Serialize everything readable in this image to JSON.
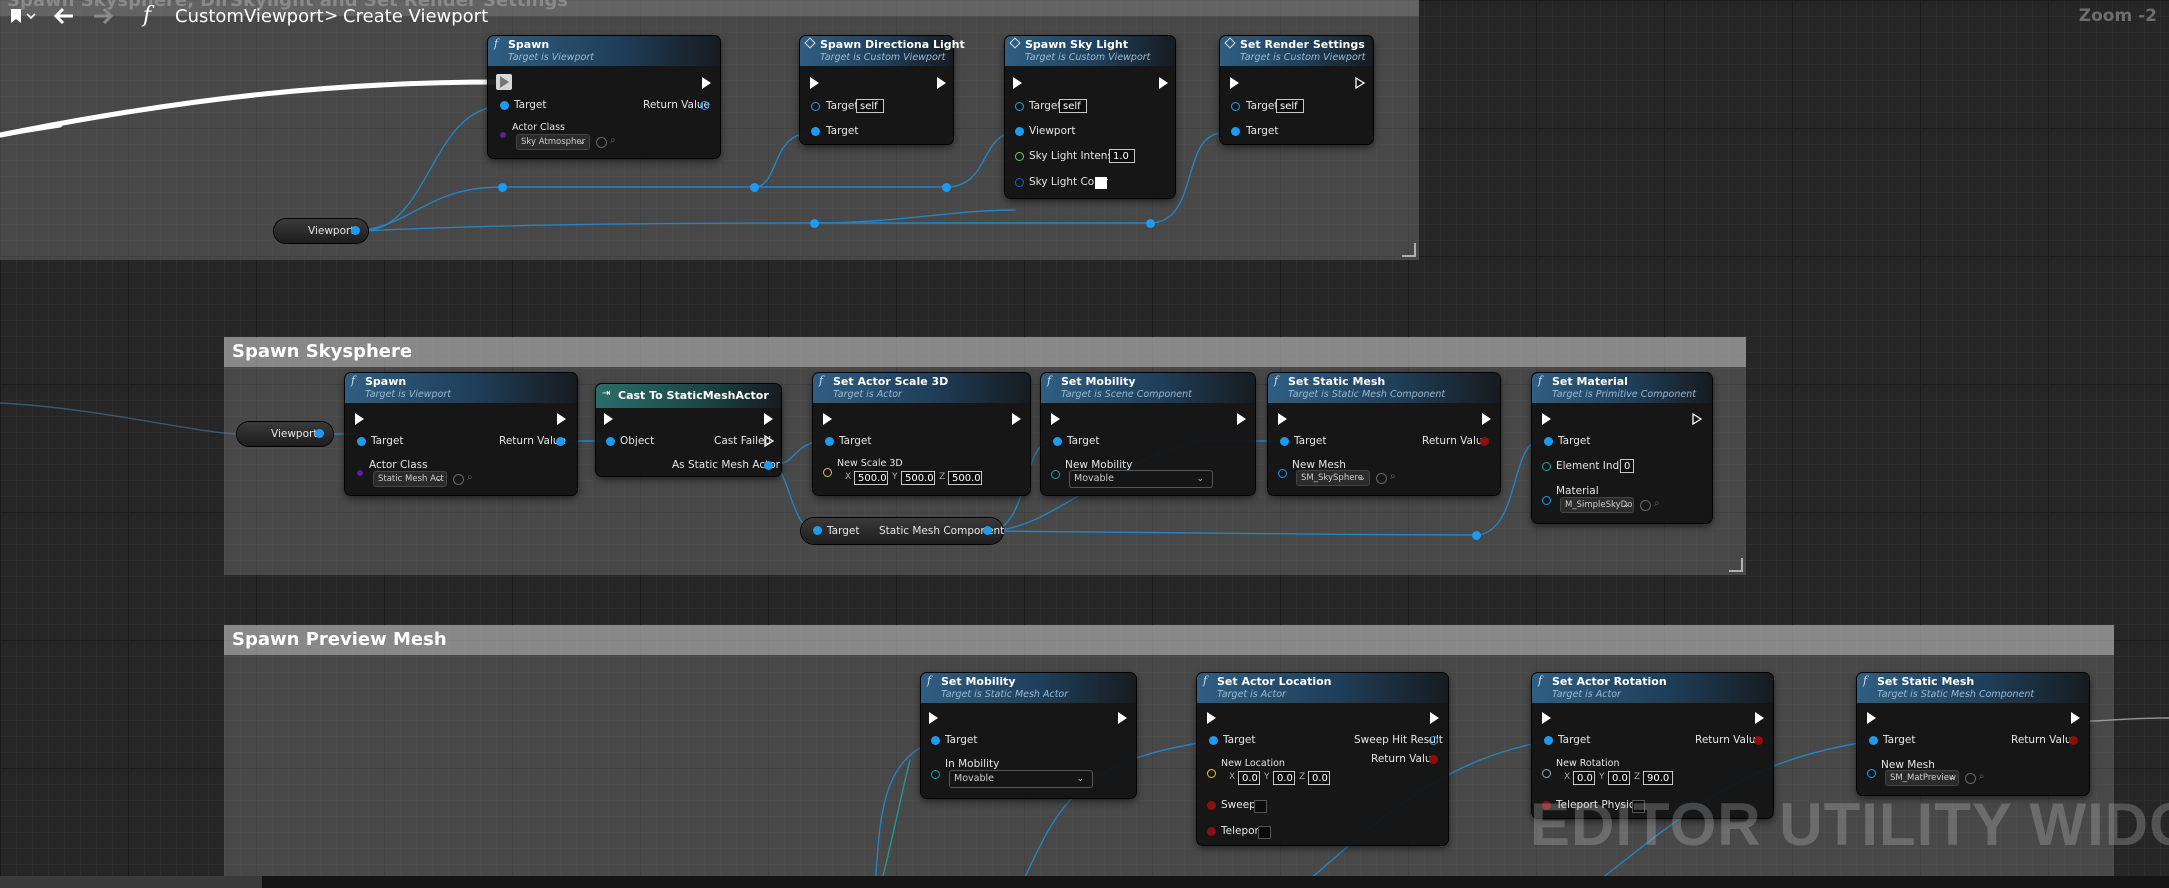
{
  "breadcrumb": {
    "function_name": "CustomViewport",
    "separator": ">",
    "graph_name": "Create Viewport"
  },
  "zoom": "Zoom -2",
  "watermark": "EDITOR UTILITY WIDGET",
  "comments": {
    "top": {
      "title": "Spawn Skysphere, DirSkylight and Set Render Settings"
    },
    "skysphere": {
      "title": "Spawn Skysphere"
    },
    "preview": {
      "title": "Spawn Preview Mesh"
    }
  },
  "top_nodes": {
    "spawn": {
      "title": "Spawn",
      "subtitle": "Target is Viewport",
      "target": "Target",
      "return": "Return Value",
      "actor_class": "Actor Class",
      "actor_class_value": "Sky Atmospher"
    },
    "dirlight": {
      "title": "Spawn Directiona Light",
      "subtitle": "Target is Custom Viewport",
      "target": "Target",
      "self": "self",
      "target2": "Target"
    },
    "skylight": {
      "title": "Spawn Sky Light",
      "subtitle": "Target is Custom Viewport",
      "target": "Target",
      "self": "self",
      "viewport": "Viewport",
      "intensity": "Sky Light Intensity",
      "intensity_value": "1.0",
      "color": "Sky Light Color"
    },
    "render": {
      "title": "Set Render Settings",
      "subtitle": "Target is Custom Viewport",
      "target": "Target",
      "self": "self",
      "target2": "Target"
    },
    "viewport_var": {
      "label": "Viewport"
    }
  },
  "sky_nodes": {
    "viewport_var": {
      "label": "Viewport"
    },
    "spawn": {
      "title": "Spawn",
      "subtitle": "Target is Viewport",
      "target": "Target",
      "return": "Return Value",
      "actor_class": "Actor Class",
      "actor_class_value": "Static Mesh Act"
    },
    "cast": {
      "title": "Cast To StaticMeshActor",
      "object": "Object",
      "failed": "Cast Failed",
      "as_actor": "As Static Mesh Actor"
    },
    "scale": {
      "title": "Set Actor Scale 3D",
      "subtitle": "Target is Actor",
      "target": "Target",
      "new_scale": "New Scale 3D",
      "x_label": "X",
      "x": "500.0",
      "y_label": "Y",
      "y": "500.0",
      "z_label": "Z",
      "z": "500.0"
    },
    "mobility": {
      "title": "Set Mobility",
      "subtitle": "Target is Scene Component",
      "target": "Target",
      "new_mobility": "New Mobility",
      "value": "Movable"
    },
    "static_mesh": {
      "title": "Set Static Mesh",
      "subtitle": "Target is Static Mesh Component",
      "target": "Target",
      "return": "Return Value",
      "new_mesh": "New Mesh",
      "mesh_value": "SM_SkySphere"
    },
    "material": {
      "title": "Set Material",
      "subtitle": "Target is Primitive Component",
      "target": "Target",
      "element_index": "Element Index",
      "element_index_value": "0",
      "material": "Material",
      "material_value": "M_SimpleSkyDo"
    },
    "component_get": {
      "target": "Target",
      "component": "Static Mesh Component"
    }
  },
  "preview_nodes": {
    "mobility": {
      "title": "Set Mobility",
      "subtitle": "Target is Static Mesh Actor",
      "target": "Target",
      "in_mobility": "In Mobility",
      "value": "Movable"
    },
    "location": {
      "title": "Set Actor Location",
      "subtitle": "Target is Actor",
      "target": "Target",
      "sweep_hit": "Sweep Hit Result",
      "return": "Return Value",
      "new_location": "New Location",
      "x_label": "X",
      "x": "0.0",
      "y_label": "Y",
      "y": "0.0",
      "z_label": "Z",
      "z": "0.0",
      "sweep": "Sweep",
      "teleport": "Teleport"
    },
    "rotation": {
      "title": "Set Actor Rotation",
      "subtitle": "Target is Actor",
      "target": "Target",
      "return": "Return Value",
      "new_rotation": "New Rotation",
      "x_label": "X",
      "x": "0.0",
      "y_label": "Y",
      "y": "0.0",
      "z_label": "Z",
      "z": "90.0",
      "teleport": "Teleport Physics"
    },
    "static_mesh": {
      "title": "Set Static Mesh",
      "subtitle": "Target is Static Mesh Component",
      "target": "Target",
      "return": "Return Value",
      "new_mesh": "New Mesh",
      "mesh_value": "SM_MatPreview"
    }
  },
  "icons": {
    "bookmark": "bookmark-icon",
    "back": "back-arrow-icon",
    "forward": "forward-arrow-icon",
    "function": "function-icon"
  },
  "colors": {
    "exec": "#ffffff",
    "object_pin": "#1e9bf0",
    "float_pin": "#5ad35a",
    "struct_pin": "#e9c23a",
    "class_pin": "#5b1e9e",
    "bool_pin": "#8a1010",
    "byte_pin": "#1aa6a0"
  }
}
